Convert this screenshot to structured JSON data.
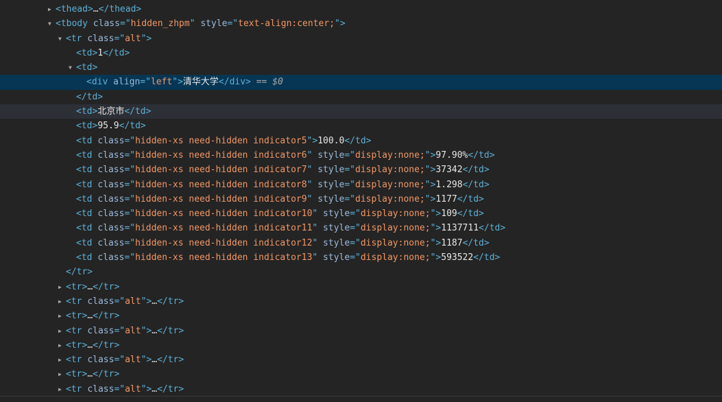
{
  "colors": {
    "background": "#242424",
    "tag": "#5db0d7",
    "attr_name": "#9bbbdc",
    "attr_value": "#f29766",
    "text": "#e8e8e8",
    "selected_row": "#073655",
    "hover_row": "#2c2f36"
  },
  "icons": {
    "expanded": "triangle-down-icon",
    "collapsed": "triangle-right-icon"
  },
  "selection_marker": {
    "eq": "==",
    "var": "$0"
  },
  "rows": [
    {
      "indent": 0,
      "toggle": "collapsed",
      "segs": [
        [
          "tag",
          "<thead>"
        ],
        [
          "ellipsis",
          "…"
        ],
        [
          "tag",
          "</thead>"
        ]
      ]
    },
    {
      "indent": 0,
      "toggle": "expanded",
      "segs": [
        [
          "tag",
          "<tbody "
        ],
        [
          "attr-name",
          "class"
        ],
        [
          "tag",
          "=\""
        ],
        [
          "attr-value",
          "hidden_zhpm"
        ],
        [
          "tag",
          "\" "
        ],
        [
          "attr-name",
          "style"
        ],
        [
          "tag",
          "=\""
        ],
        [
          "attr-value",
          "text-align:center;"
        ],
        [
          "tag",
          "\">"
        ]
      ]
    },
    {
      "indent": 1,
      "toggle": "expanded",
      "segs": [
        [
          "tag",
          "<tr "
        ],
        [
          "attr-name",
          "class"
        ],
        [
          "tag",
          "=\""
        ],
        [
          "attr-value",
          "alt"
        ],
        [
          "tag",
          "\">"
        ]
      ]
    },
    {
      "indent": 2,
      "toggle": "none",
      "segs": [
        [
          "tag",
          "<td>"
        ],
        [
          "text",
          "1"
        ],
        [
          "tag",
          "</td>"
        ]
      ]
    },
    {
      "indent": 2,
      "toggle": "expanded",
      "segs": [
        [
          "tag",
          "<td>"
        ]
      ]
    },
    {
      "indent": 3,
      "toggle": "none",
      "selected": true,
      "segs": [
        [
          "tag",
          "<div "
        ],
        [
          "attr-name",
          "align"
        ],
        [
          "tag",
          "=\""
        ],
        [
          "attr-value",
          "left"
        ],
        [
          "tag",
          "\">"
        ],
        [
          "text",
          "清华大学"
        ],
        [
          "tag",
          "</div>"
        ]
      ]
    },
    {
      "indent": 2,
      "toggle": "none",
      "segs": [
        [
          "tag",
          "</td>"
        ]
      ]
    },
    {
      "indent": 2,
      "toggle": "none",
      "hovered": true,
      "segs": [
        [
          "tag",
          "<td>"
        ],
        [
          "text",
          "北京市"
        ],
        [
          "tag",
          "</td>"
        ]
      ]
    },
    {
      "indent": 2,
      "toggle": "none",
      "segs": [
        [
          "tag",
          "<td>"
        ],
        [
          "text",
          "95.9"
        ],
        [
          "tag",
          "</td>"
        ]
      ]
    },
    {
      "indent": 2,
      "toggle": "none",
      "segs": [
        [
          "tag",
          "<td "
        ],
        [
          "attr-name",
          "class"
        ],
        [
          "tag",
          "=\""
        ],
        [
          "attr-value",
          "hidden-xs need-hidden indicator5"
        ],
        [
          "tag",
          "\">"
        ],
        [
          "text",
          "100.0"
        ],
        [
          "tag",
          "</td>"
        ]
      ]
    },
    {
      "indent": 2,
      "toggle": "none",
      "segs": [
        [
          "tag",
          "<td "
        ],
        [
          "attr-name",
          "class"
        ],
        [
          "tag",
          "=\""
        ],
        [
          "attr-value",
          "hidden-xs need-hidden indicator6"
        ],
        [
          "tag",
          "\" "
        ],
        [
          "attr-name",
          "style"
        ],
        [
          "tag",
          "=\""
        ],
        [
          "attr-value",
          "display:none;"
        ],
        [
          "tag",
          "\">"
        ],
        [
          "text",
          "97.90%"
        ],
        [
          "tag",
          "</td>"
        ]
      ]
    },
    {
      "indent": 2,
      "toggle": "none",
      "segs": [
        [
          "tag",
          "<td "
        ],
        [
          "attr-name",
          "class"
        ],
        [
          "tag",
          "=\""
        ],
        [
          "attr-value",
          "hidden-xs need-hidden indicator7"
        ],
        [
          "tag",
          "\" "
        ],
        [
          "attr-name",
          "style"
        ],
        [
          "tag",
          "=\""
        ],
        [
          "attr-value",
          "display:none;"
        ],
        [
          "tag",
          "\">"
        ],
        [
          "text",
          "37342"
        ],
        [
          "tag",
          "</td>"
        ]
      ]
    },
    {
      "indent": 2,
      "toggle": "none",
      "segs": [
        [
          "tag",
          "<td "
        ],
        [
          "attr-name",
          "class"
        ],
        [
          "tag",
          "=\""
        ],
        [
          "attr-value",
          "hidden-xs need-hidden indicator8"
        ],
        [
          "tag",
          "\" "
        ],
        [
          "attr-name",
          "style"
        ],
        [
          "tag",
          "=\""
        ],
        [
          "attr-value",
          "display:none;"
        ],
        [
          "tag",
          "\">"
        ],
        [
          "text",
          "1.298"
        ],
        [
          "tag",
          "</td>"
        ]
      ]
    },
    {
      "indent": 2,
      "toggle": "none",
      "segs": [
        [
          "tag",
          "<td "
        ],
        [
          "attr-name",
          "class"
        ],
        [
          "tag",
          "=\""
        ],
        [
          "attr-value",
          "hidden-xs need-hidden indicator9"
        ],
        [
          "tag",
          "\" "
        ],
        [
          "attr-name",
          "style"
        ],
        [
          "tag",
          "=\""
        ],
        [
          "attr-value",
          "display:none;"
        ],
        [
          "tag",
          "\">"
        ],
        [
          "text",
          "1177"
        ],
        [
          "tag",
          "</td>"
        ]
      ]
    },
    {
      "indent": 2,
      "toggle": "none",
      "segs": [
        [
          "tag",
          "<td "
        ],
        [
          "attr-name",
          "class"
        ],
        [
          "tag",
          "=\""
        ],
        [
          "attr-value",
          "hidden-xs need-hidden indicator10"
        ],
        [
          "tag",
          "\" "
        ],
        [
          "attr-name",
          "style"
        ],
        [
          "tag",
          "=\""
        ],
        [
          "attr-value",
          "display:none;"
        ],
        [
          "tag",
          "\">"
        ],
        [
          "text",
          "109"
        ],
        [
          "tag",
          "</td>"
        ]
      ]
    },
    {
      "indent": 2,
      "toggle": "none",
      "segs": [
        [
          "tag",
          "<td "
        ],
        [
          "attr-name",
          "class"
        ],
        [
          "tag",
          "=\""
        ],
        [
          "attr-value",
          "hidden-xs need-hidden indicator11"
        ],
        [
          "tag",
          "\" "
        ],
        [
          "attr-name",
          "style"
        ],
        [
          "tag",
          "=\""
        ],
        [
          "attr-value",
          "display:none;"
        ],
        [
          "tag",
          "\">"
        ],
        [
          "text",
          "1137711"
        ],
        [
          "tag",
          "</td>"
        ]
      ]
    },
    {
      "indent": 2,
      "toggle": "none",
      "segs": [
        [
          "tag",
          "<td "
        ],
        [
          "attr-name",
          "class"
        ],
        [
          "tag",
          "=\""
        ],
        [
          "attr-value",
          "hidden-xs need-hidden indicator12"
        ],
        [
          "tag",
          "\" "
        ],
        [
          "attr-name",
          "style"
        ],
        [
          "tag",
          "=\""
        ],
        [
          "attr-value",
          "display:none;"
        ],
        [
          "tag",
          "\">"
        ],
        [
          "text",
          "1187"
        ],
        [
          "tag",
          "</td>"
        ]
      ]
    },
    {
      "indent": 2,
      "toggle": "none",
      "segs": [
        [
          "tag",
          "<td "
        ],
        [
          "attr-name",
          "class"
        ],
        [
          "tag",
          "=\""
        ],
        [
          "attr-value",
          "hidden-xs need-hidden indicator13"
        ],
        [
          "tag",
          "\" "
        ],
        [
          "attr-name",
          "style"
        ],
        [
          "tag",
          "=\""
        ],
        [
          "attr-value",
          "display:none;"
        ],
        [
          "tag",
          "\">"
        ],
        [
          "text",
          "593522"
        ],
        [
          "tag",
          "</td>"
        ]
      ]
    },
    {
      "indent": 1,
      "toggle": "none",
      "segs": [
        [
          "tag",
          "</tr>"
        ]
      ]
    },
    {
      "indent": 1,
      "toggle": "collapsed",
      "segs": [
        [
          "tag",
          "<tr>"
        ],
        [
          "ellipsis",
          "…"
        ],
        [
          "tag",
          "</tr>"
        ]
      ]
    },
    {
      "indent": 1,
      "toggle": "collapsed",
      "segs": [
        [
          "tag",
          "<tr "
        ],
        [
          "attr-name",
          "class"
        ],
        [
          "tag",
          "=\""
        ],
        [
          "attr-value",
          "alt"
        ],
        [
          "tag",
          "\">"
        ],
        [
          "ellipsis",
          "…"
        ],
        [
          "tag",
          "</tr>"
        ]
      ]
    },
    {
      "indent": 1,
      "toggle": "collapsed",
      "segs": [
        [
          "tag",
          "<tr>"
        ],
        [
          "ellipsis",
          "…"
        ],
        [
          "tag",
          "</tr>"
        ]
      ]
    },
    {
      "indent": 1,
      "toggle": "collapsed",
      "segs": [
        [
          "tag",
          "<tr "
        ],
        [
          "attr-name",
          "class"
        ],
        [
          "tag",
          "=\""
        ],
        [
          "attr-value",
          "alt"
        ],
        [
          "tag",
          "\">"
        ],
        [
          "ellipsis",
          "…"
        ],
        [
          "tag",
          "</tr>"
        ]
      ]
    },
    {
      "indent": 1,
      "toggle": "collapsed",
      "segs": [
        [
          "tag",
          "<tr>"
        ],
        [
          "ellipsis",
          "…"
        ],
        [
          "tag",
          "</tr>"
        ]
      ]
    },
    {
      "indent": 1,
      "toggle": "collapsed",
      "segs": [
        [
          "tag",
          "<tr "
        ],
        [
          "attr-name",
          "class"
        ],
        [
          "tag",
          "=\""
        ],
        [
          "attr-value",
          "alt"
        ],
        [
          "tag",
          "\">"
        ],
        [
          "ellipsis",
          "…"
        ],
        [
          "tag",
          "</tr>"
        ]
      ]
    },
    {
      "indent": 1,
      "toggle": "collapsed",
      "segs": [
        [
          "tag",
          "<tr>"
        ],
        [
          "ellipsis",
          "…"
        ],
        [
          "tag",
          "</tr>"
        ]
      ]
    },
    {
      "indent": 1,
      "toggle": "collapsed",
      "segs": [
        [
          "tag",
          "<tr "
        ],
        [
          "attr-name",
          "class"
        ],
        [
          "tag",
          "=\""
        ],
        [
          "attr-value",
          "alt"
        ],
        [
          "tag",
          "\">"
        ],
        [
          "ellipsis",
          "…"
        ],
        [
          "tag",
          "</tr>"
        ]
      ]
    }
  ]
}
